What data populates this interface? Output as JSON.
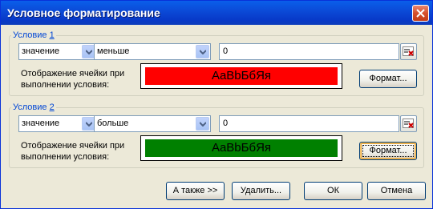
{
  "window": {
    "title": "Условное форматирование"
  },
  "conditions": [
    {
      "group_label_prefix": "Условие ",
      "group_label_number": "1",
      "type_value": "значение",
      "operator_value": "меньше",
      "input_value": "0",
      "preview_label": "Отображение ячейки при выполнении условия:",
      "preview_sample": "AaBbБбЯя",
      "preview_color": "#ff0000",
      "format_label": "Формат..."
    },
    {
      "group_label_prefix": "Условие ",
      "group_label_number": "2",
      "type_value": "значение",
      "operator_value": "больше",
      "input_value": "0",
      "preview_label": "Отображение ячейки при выполнении условия:",
      "preview_sample": "AaBbБбЯя",
      "preview_color": "#008000",
      "format_label": "Формат..."
    }
  ],
  "buttons": {
    "also_label": "А также >>",
    "delete_label": "Удалить...",
    "ok_label": "ОК",
    "cancel_label": "Отмена"
  }
}
